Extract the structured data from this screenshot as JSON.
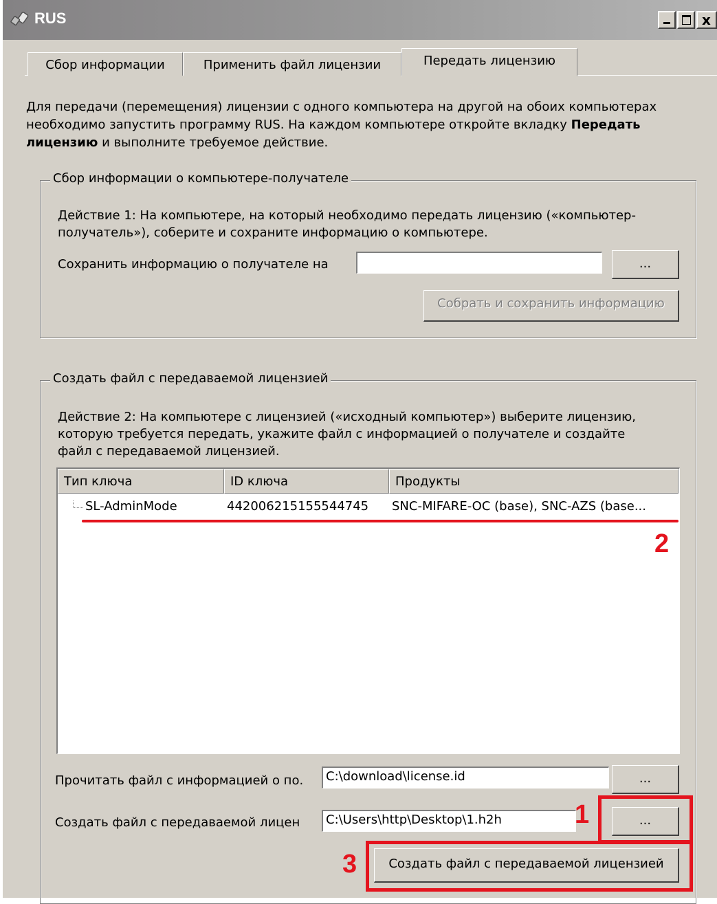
{
  "window": {
    "title": "RUS",
    "controls": [
      "minimize",
      "maximize",
      "close"
    ],
    "close_glyph": "x"
  },
  "tabs": [
    {
      "label": "Сбор информации",
      "active": false
    },
    {
      "label": "Применить файл лицензии",
      "active": false
    },
    {
      "label": "Передать лицензию",
      "active": true
    }
  ],
  "intro": {
    "line1": "Для передачи (перемещения) лицензии с одного компьютера на другой на обоих компьютерах",
    "line2_prefix": "необходимо запустить программу RUS. На каждом компьютере откройте вкладку ",
    "line2_bold": "Передать",
    "line3_bold": "лицензию",
    "line3_suffix": " и выполните требуемое действие."
  },
  "group_receiver": {
    "legend": "Сбор информации о компьютере-получателе",
    "description_line1": "Действие 1: На компьютере, на который необходимо передать лицензию («компьютер-",
    "description_line2": "получатель»), соберите и сохраните информацию о компьютере.",
    "save_label": "Сохранить информацию о получателе на",
    "save_value": "",
    "browse_label": "...",
    "collect_button": "Собрать и сохранить информацию"
  },
  "group_create": {
    "legend": "Создать файл с передаваемой лицензией",
    "description_line1": "Действие 2: На компьютере с лицензией («исходный компьютер») выберите лицензию,",
    "description_line2": "которую требуется передать, укажите файл с информацией о получателе и создайте",
    "description_line3": "файл с передаваемой лицензией.",
    "columns": [
      "Тип ключа",
      "ID ключа",
      "Продукты"
    ],
    "rows": [
      {
        "key_type": "SL-AdminMode",
        "key_id": "442006215155544745",
        "products": "SNC-MIFARE-OC (base), SNC-AZS (base..."
      }
    ],
    "read_label": "Прочитать файл с информацией о по.",
    "read_value": "C:\\download\\license.id",
    "read_browse": "...",
    "create_label": "Создать файл с передаваемой лицен",
    "create_value": "C:\\Users\\http\\Desktop\\1.h2h",
    "create_browse": "...",
    "create_button": "Создать файл с передаваемой лицензией"
  },
  "annotations": {
    "marker_1": "1",
    "marker_2": "2",
    "marker_3": "3",
    "color": "#e4141e"
  },
  "colors": {
    "window_bg": "#d4d0c8",
    "titlebar": "#9a9a9a"
  }
}
